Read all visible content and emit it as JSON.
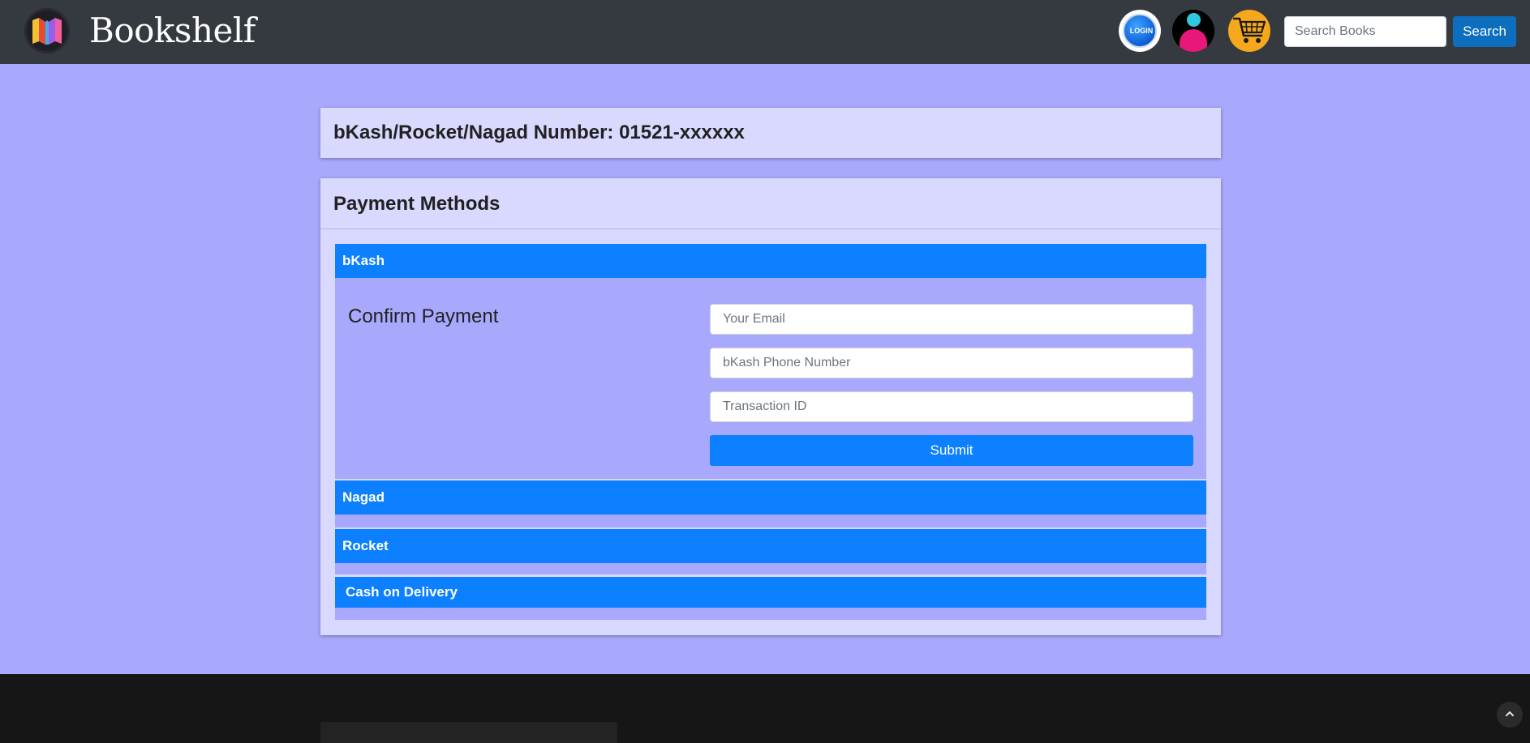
{
  "header": {
    "brand_name": "Bookshelf",
    "login_label": "LOGIN",
    "search_placeholder": "Search Books",
    "search_button": "Search"
  },
  "info_card": {
    "title": "bKash/Rocket/Nagad Number: 01521-xxxxxx"
  },
  "payment_methods": {
    "title": "Payment Methods",
    "methods": [
      {
        "label": "bKash",
        "expanded": true
      },
      {
        "label": "Nagad",
        "expanded": false
      },
      {
        "label": "Rocket",
        "expanded": false
      },
      {
        "label": "Cash on Delivery",
        "expanded": false
      }
    ],
    "form": {
      "title": "Confirm Payment",
      "email_placeholder": "Your Email",
      "phone_placeholder": "bKash Phone Number",
      "transaction_placeholder": "Transaction ID",
      "submit_label": "Submit"
    }
  },
  "icons": {
    "logo": "book-logo-icon",
    "login": "login-badge-icon",
    "profile": "user-profile-icon",
    "cart": "shopping-cart-icon",
    "scroll_top": "chevron-up-icon"
  },
  "colors": {
    "navbar": "#343a40",
    "page_background": "#a8a8fd",
    "card_background": "#d9d9ff",
    "method_bar": "#0d80ff",
    "search_button": "#0d6ebd",
    "footer": "#161616"
  }
}
